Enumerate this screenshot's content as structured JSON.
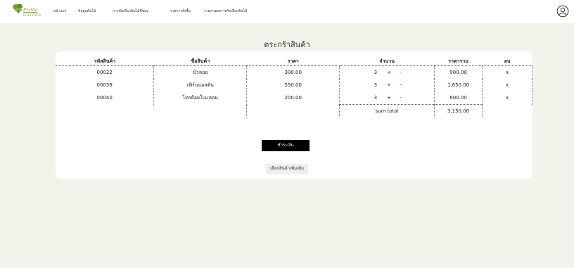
{
  "brand": {
    "line1": "Pratha",
    "line2": "Garden",
    "accent": "#8aa06a"
  },
  "nav": {
    "items": [
      {
        "label": "หน้าแรก"
      },
      {
        "label": "ข้อมูลต้นไม้"
      },
      {
        "label": "การคัดเลือกต้นไม้ที่ชอบ"
      },
      {
        "label": "รายการสั่งซื้อ"
      },
      {
        "label": "รายงานผลการคัดเลือกต้นไม้"
      }
    ],
    "user_icon": "user-circle-icon"
  },
  "cart": {
    "title": "ตระกร้าสินค้า",
    "headers": [
      "รหัสสินค้า",
      "ชื่อสินค้า",
      "ราคา",
      "จำนวน",
      "ราคารวม",
      "ลบ"
    ],
    "rows": [
      {
        "code": "00022",
        "name": "บัวลอย",
        "price": "300.00",
        "qty": "3",
        "plus": "+",
        "minus": "-",
        "total": "900.00",
        "del": "x"
      },
      {
        "code": "00039",
        "name": "เฟิร์นบอสตัน",
        "price": "550.00",
        "qty": "3",
        "plus": "+",
        "minus": "-",
        "total": "1,650.00",
        "del": "x"
      },
      {
        "code": "00040",
        "name": "ไทรย้อยใบแหลม",
        "price": "200.00",
        "qty": "3",
        "plus": "+",
        "minus": "-",
        "total": "600.00",
        "del": "x"
      }
    ],
    "sum_label": "sum total",
    "sum_value": "3,150.00"
  },
  "actions": {
    "pay": "ชำระเงิน",
    "more": "เลือกสินค้าเพิ่มเติม"
  }
}
